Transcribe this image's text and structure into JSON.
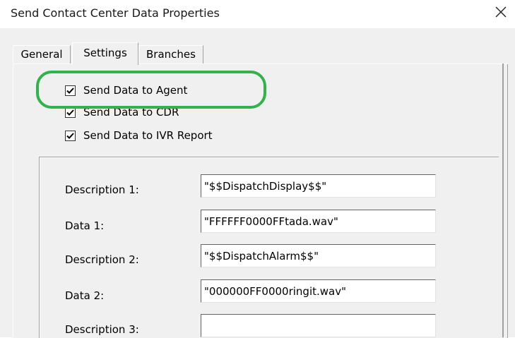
{
  "window": {
    "title": "Send Contact Center Data Properties"
  },
  "tabs": [
    {
      "label": "General",
      "active": false
    },
    {
      "label": "Settings",
      "active": true
    },
    {
      "label": "Branches",
      "active": false
    }
  ],
  "checkboxes": [
    {
      "label": "Send Data to Agent",
      "checked": true
    },
    {
      "label": "Send Data to CDR",
      "checked": true
    },
    {
      "label": "Send Data to IVR Report",
      "checked": true
    }
  ],
  "fields": [
    {
      "label": "Description 1:",
      "value": "\"$$DispatchDisplay$$\""
    },
    {
      "label": "Data 1:",
      "value": "\"FFFFFF0000FFtada.wav\""
    },
    {
      "label": "Description 2:",
      "value": "\"$$DispatchAlarm$$\""
    },
    {
      "label": "Data 2:",
      "value": "\"000000FF0000ringit.wav\""
    },
    {
      "label": "Description 3:",
      "value": ""
    }
  ],
  "colors": {
    "highlight": "#2fb34a",
    "dialog_bg": "#f0f0f0"
  }
}
